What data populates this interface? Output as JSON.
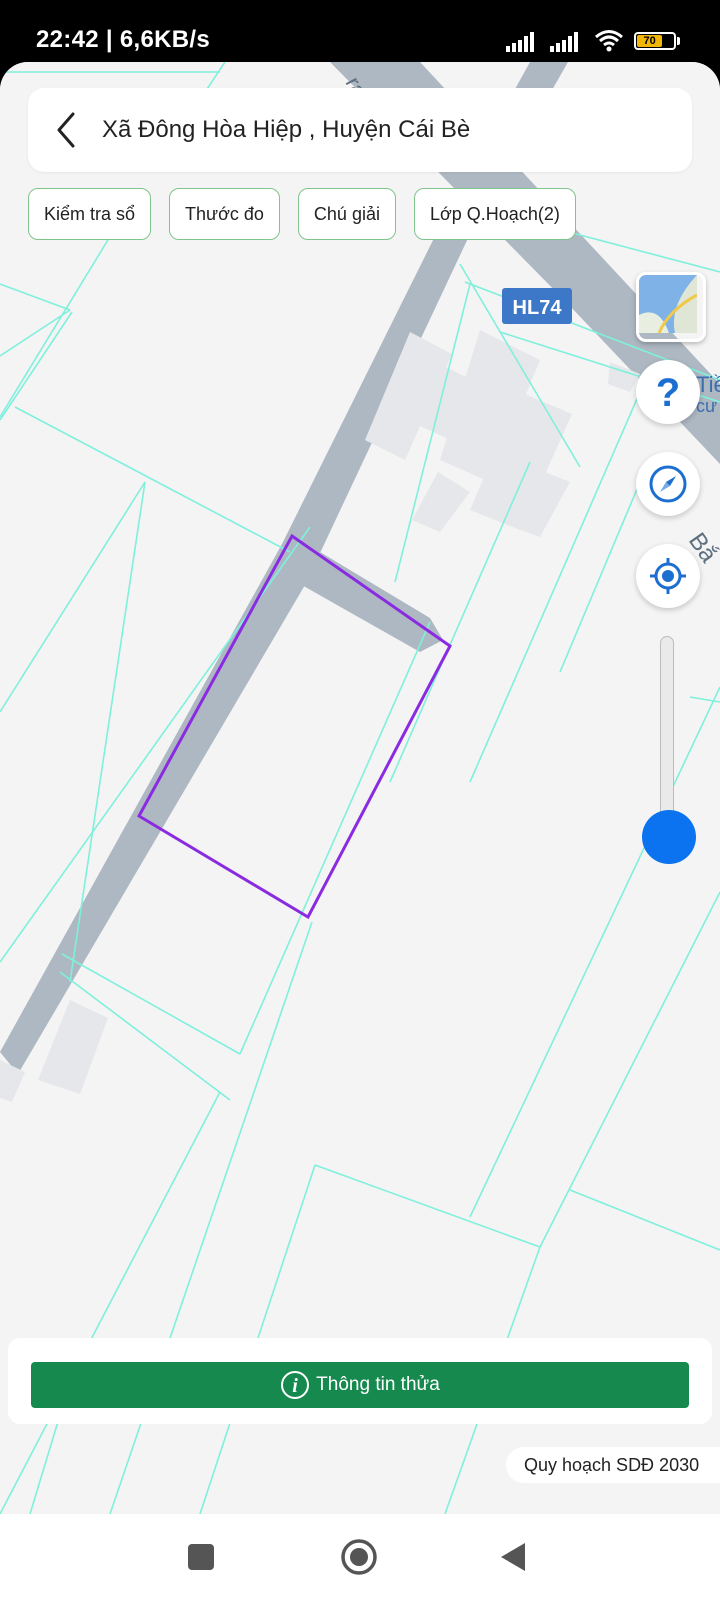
{
  "status_bar": {
    "time_speed": "22:42 | 6,6KB/s",
    "battery_level": "70"
  },
  "header": {
    "title": "Xã Đông Hòa Hiệp , Huyện Cái Bè",
    "back_icon": "chevron-left-icon"
  },
  "chips": [
    {
      "label": "Kiểm tra sổ"
    },
    {
      "label": "Thước đo"
    },
    {
      "label": "Chú giải"
    },
    {
      "label": "Lớp Q.Hoạch(2)"
    }
  ],
  "map": {
    "road_shield": "HL74",
    "street_fragments": [
      "Tiề",
      "cư",
      "Bắ",
      "ran"
    ],
    "colors": {
      "parcel_line": "#7ff0dc",
      "road": "#aeb8c2",
      "selection": "#8a2be2",
      "background": "#f4f4f4",
      "building": "#e6e7ea"
    }
  },
  "controls": {
    "help_icon": "question-icon",
    "compass_icon": "compass-icon",
    "locate_icon": "locate-icon",
    "zoom_level": 0.13
  },
  "bottom": {
    "info_button_label": "Thông tin thửa",
    "info_icon": "info-icon",
    "plan_label": "Quy hoạch SDĐ 2030"
  },
  "nav": {
    "recents_icon": "square-icon",
    "home_icon": "home-circle-icon",
    "back_icon": "triangle-back-icon"
  },
  "colors": {
    "primary_green": "#168a4e",
    "chip_border": "#7fc58c",
    "accent_blue": "#0b73f0"
  }
}
